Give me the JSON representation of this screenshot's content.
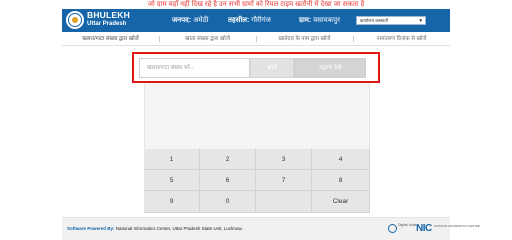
{
  "notice": "जो ग्राम यहाँ नहीं दिख रहे है उन सभी ग्रामों को रियल टाइम खतौनी में देखा जा सकता है",
  "header": {
    "brand_title": "BHULEKH",
    "brand_subtitle": "Uttar Pradesh",
    "district_label": "जनपद:",
    "district_value": "अमेठी",
    "tehsil_label": "तहसील:",
    "tehsil_value": "गौरीगंज",
    "village_label": "ग्राम:",
    "village_value": "वसायकपुर",
    "village_select": "कार्यालय कस्बाती"
  },
  "tabs": [
    {
      "label": "खसरा/गाटा संख्या द्वारा खोजें",
      "active": true
    },
    {
      "label": "खाता संख्या द्वारा खोजें",
      "active": false
    },
    {
      "label": "खातेदार के नाम द्वारा खोजें",
      "active": false
    },
    {
      "label": "नामांतरण दिनांक से खोजें",
      "active": false
    }
  ],
  "search": {
    "placeholder": "खसरा/गाटा संख्या भरें...",
    "search_button": "खोजें",
    "view_button": "उद्धरण देखें"
  },
  "keypad": {
    "keys": [
      "1",
      "2",
      "3",
      "4",
      "5",
      "6",
      "7",
      "8",
      "9",
      "0",
      "",
      "Clear"
    ]
  },
  "footer": {
    "prefix": "Software Powered By:",
    "org": "National Informatics Center, Uttar Pradesh State Unit, Lucknow.",
    "digital_india_text": "Digital India",
    "nic_logo_text": "NIC",
    "nic_sub_text": "NATIONAL INFORMATICS CENTRE"
  },
  "colors": {
    "header_blue": "#1565a8",
    "notice_red": "#e53935",
    "highlight_red": "#e01515"
  }
}
